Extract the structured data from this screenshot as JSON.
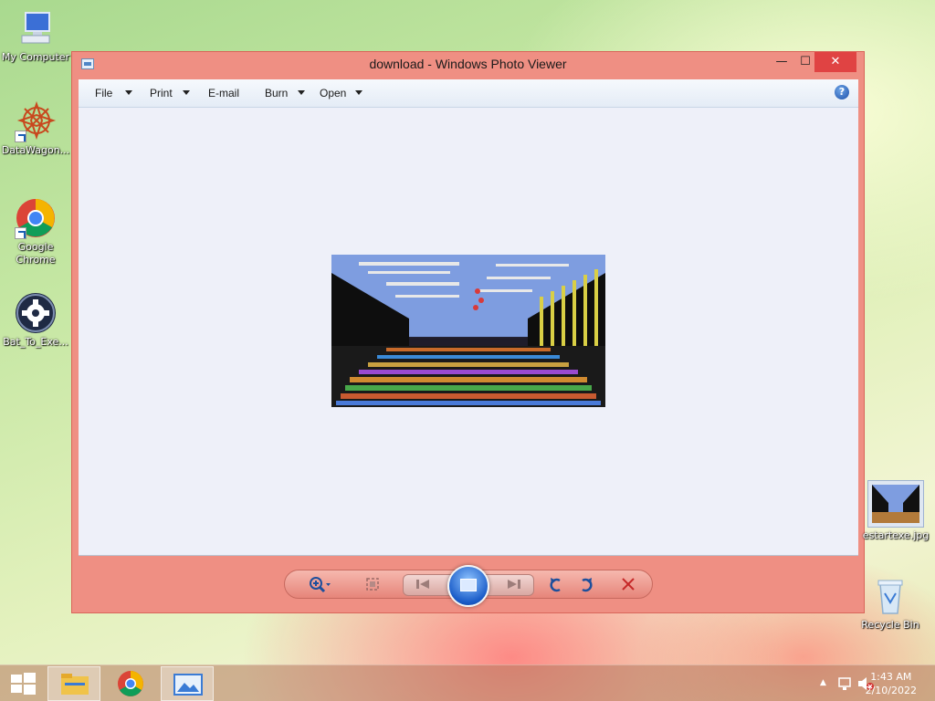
{
  "desktop": {
    "icons": [
      {
        "label": "My Computer"
      },
      {
        "label": "DataWagon..."
      },
      {
        "label": "Google Chrome"
      },
      {
        "label": "Bat_To_Exe..."
      }
    ],
    "file": {
      "label": "estartexe.jpg"
    },
    "recycle": {
      "label": "Recycle Bin"
    }
  },
  "window": {
    "title": "download - Windows Photo Viewer",
    "controls": {
      "minimize": "—",
      "maximize": "☐",
      "close": "✕"
    },
    "menu": {
      "file": "File",
      "print": "Print",
      "email": "E-mail",
      "burn": "Burn",
      "open": "Open",
      "help": "?"
    }
  },
  "toolbar": {
    "zoom": "zoom-icon",
    "actual_size": "actual-size-icon",
    "previous": "previous-icon",
    "slideshow": "slideshow-icon",
    "next": "next-icon",
    "rotate_ccw": "rotate-counterclockwise-icon",
    "rotate_cw": "rotate-clockwise-icon",
    "delete": "delete-icon"
  },
  "taskbar": {
    "time": "1:43 AM",
    "date": "2/10/2022"
  },
  "colors": {
    "window_frame": "#ef8f83",
    "close_button": "#e04343",
    "slideshow_blue": "#1a5cc8"
  }
}
